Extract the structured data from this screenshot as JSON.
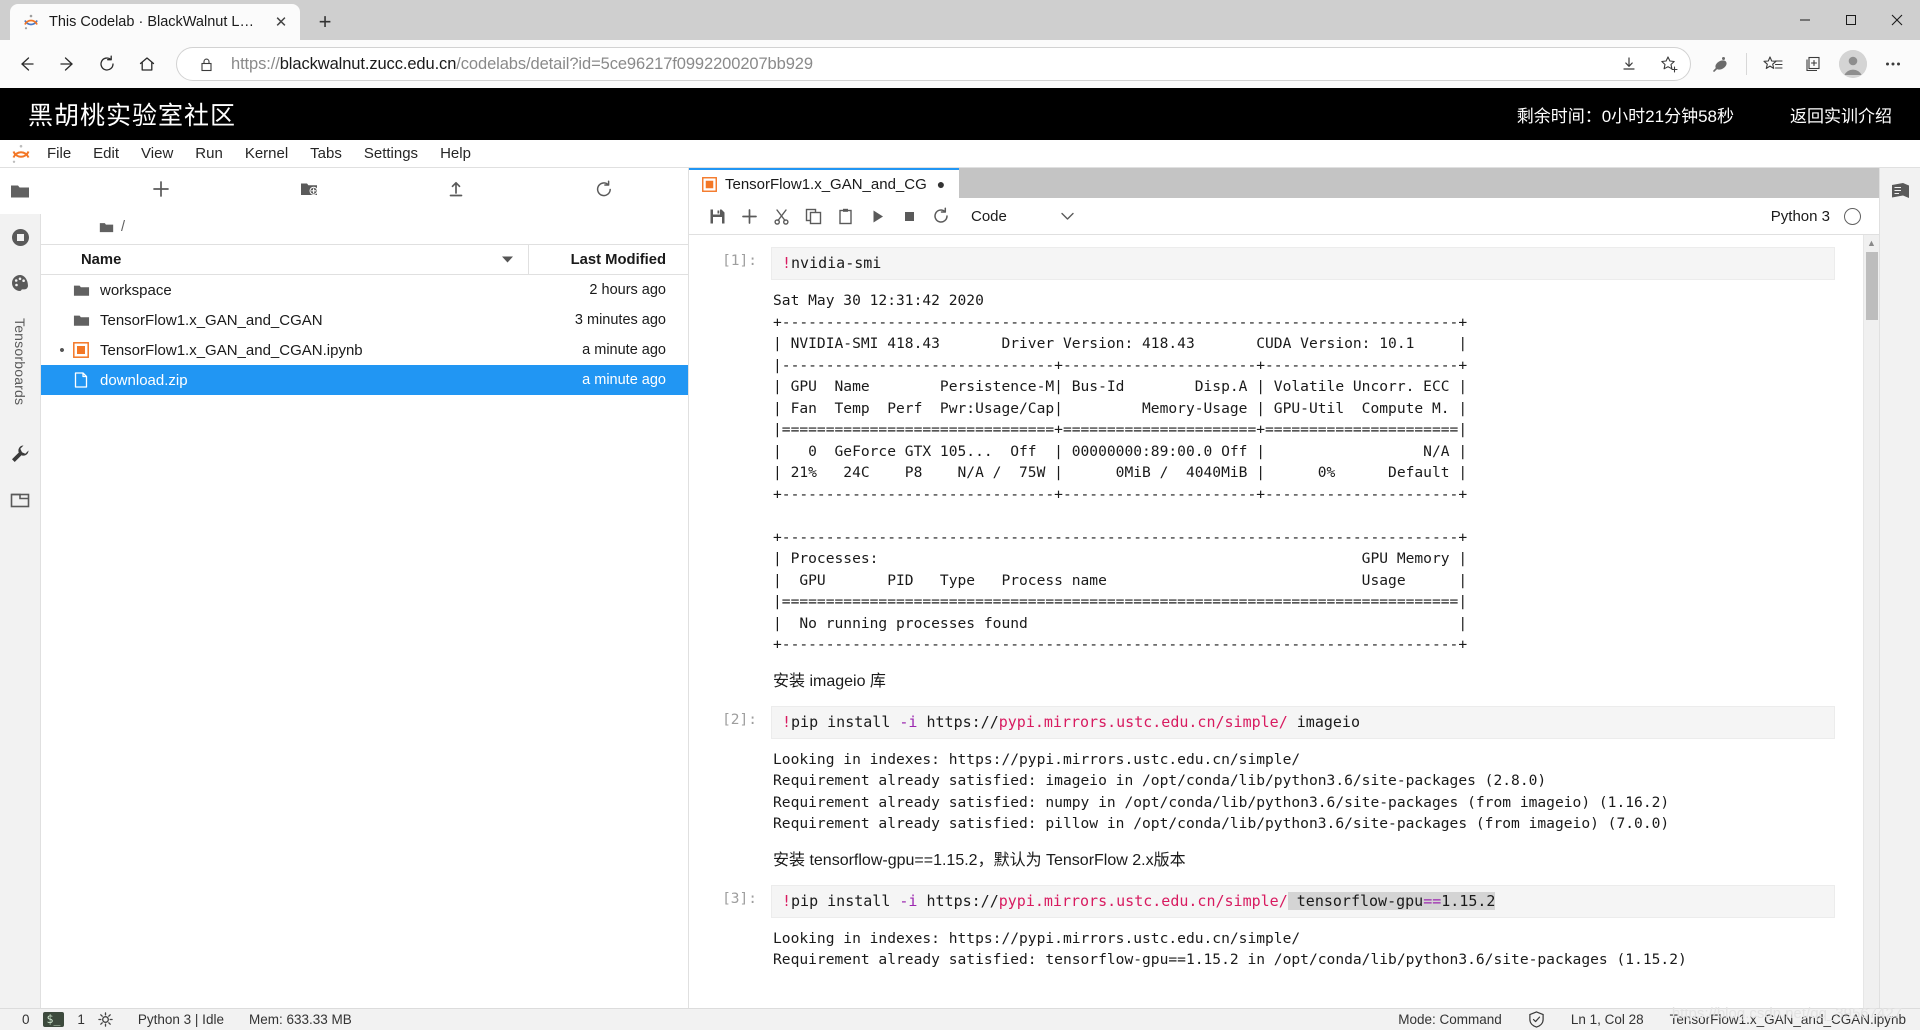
{
  "browser": {
    "tab": {
      "title": "This Codelab · BlackWalnut Labs.",
      "favicon": "jupyter-favicon",
      "close_label": "✕"
    },
    "new_tab_label": "+",
    "window_controls": {
      "minimize": "minimize-icon",
      "maximize": "maximize-icon",
      "close": "close-icon"
    },
    "nav": {
      "back": "back-arrow-icon",
      "forward": "forward-arrow-icon",
      "reload": "reload-icon",
      "home": "home-icon"
    },
    "omnibox": {
      "lock": "lock-icon",
      "url_scheme": "https://",
      "url_host": "blackwalnut.zucc.edu.cn",
      "url_path": "/codelabs/detail?id=5ce96217f0992200207bb929",
      "full_url": "https://blackwalnut.zucc.edu.cn/codelabs/detail?id=5ce96217f0992200207bb929",
      "download_icon": "download-icon",
      "favorite_icon": "add-favorite-icon"
    },
    "toolbar_icons": [
      "collections-radar-icon",
      "favorites-list-icon",
      "collections-icon",
      "profile-avatar-icon",
      "more-options-icon"
    ]
  },
  "site_header": {
    "logo": "黑胡桃实验室社区",
    "remaining_time": "剩余时间：0小时21分钟58秒",
    "back_link": "返回实训介绍"
  },
  "jupyter": {
    "menu": [
      "File",
      "Edit",
      "View",
      "Run",
      "Kernel",
      "Tabs",
      "Settings",
      "Help"
    ],
    "left_rail": [
      {
        "name": "file-browser-icon",
        "label": "",
        "active": true
      },
      {
        "name": "running-terminals-icon",
        "label": "",
        "active": false
      },
      {
        "name": "extension-manager-icon",
        "label": "",
        "active": false
      },
      {
        "name": "tensorboards-icon",
        "label": "Tensorboards",
        "active": false
      },
      {
        "name": "wrench-icon",
        "label": "",
        "active": false
      },
      {
        "name": "open-tabs-icon",
        "label": "",
        "active": false
      }
    ],
    "right_rail": [
      {
        "name": "table-of-contents-icon",
        "label": ""
      }
    ],
    "filebrowser": {
      "toolbar": [
        "new-launcher-icon",
        "new-folder-icon",
        "upload-icon",
        "refresh-icon"
      ],
      "breadcrumb": "/",
      "columns": {
        "name": "Name",
        "last_modified": "Last Modified"
      },
      "items": [
        {
          "name": "workspace",
          "modified": "2 hours ago",
          "type": "folder",
          "selected": false,
          "dirty": false
        },
        {
          "name": "TensorFlow1.x_GAN_and_CGAN",
          "modified": "3 minutes ago",
          "type": "folder",
          "selected": false,
          "dirty": false
        },
        {
          "name": "TensorFlow1.x_GAN_and_CGAN.ipynb",
          "modified": "a minute ago",
          "type": "notebook",
          "selected": false,
          "dirty": true
        },
        {
          "name": "download.zip",
          "modified": "a minute ago",
          "type": "file",
          "selected": true,
          "dirty": false
        }
      ]
    },
    "notebook": {
      "tab_title": "TensorFlow1.x_GAN_and_CG",
      "tab_dirty_marker": "●",
      "toolbar_icons": [
        "save-icon",
        "insert-cell-icon",
        "cut-icon",
        "copy-icon",
        "paste-icon",
        "run-icon",
        "stop-icon",
        "restart-icon"
      ],
      "cell_type": "Code",
      "cell_type_caret": "chevron-down-icon",
      "kernel_name": "Python 3",
      "kernel_status": "kernel-idle-icon",
      "cells": [
        {
          "prompt": "[1]:",
          "source_bang": "!",
          "source_rest": "nvidia-smi",
          "output": "Sat May 30 12:31:42 2020       \n+-----------------------------------------------------------------------------+\n| NVIDIA-SMI 418.43       Driver Version: 418.43       CUDA Version: 10.1     |\n|-------------------------------+----------------------+----------------------+\n| GPU  Name        Persistence-M| Bus-Id        Disp.A | Volatile Uncorr. ECC |\n| Fan  Temp  Perf  Pwr:Usage/Cap|         Memory-Usage | GPU-Util  Compute M. |\n|===============================+======================+======================|\n|   0  GeForce GTX 105...  Off  | 00000000:89:00.0 Off |                  N/A |\n| 21%   24C    P8    N/A /  75W |      0MiB /  4040MiB |      0%      Default |\n+-------------------------------+----------------------+----------------------+\n                                                                               \n+-----------------------------------------------------------------------------+\n| Processes:                                                       GPU Memory |\n|  GPU       PID   Type   Process name                             Usage      |\n|=============================================================================|\n|  No running processes found                                                 |\n+-----------------------------------------------------------------------------+"
        },
        {
          "markdown": "安装 imageio 库"
        },
        {
          "prompt": "[2]:",
          "source_bang": "!",
          "source_pre": "pip install ",
          "source_flag": "-i",
          "source_url_a": " https://",
          "source_url_host": "pypi.mirrors.ustc.edu.cn",
          "source_url_b": "/simple/",
          "source_pkg": " imageio",
          "output": "Looking in indexes: https://pypi.mirrors.ustc.edu.cn/simple/\nRequirement already satisfied: imageio in /opt/conda/lib/python3.6/site-packages (2.8.0)\nRequirement already satisfied: numpy in /opt/conda/lib/python3.6/site-packages (from imageio) (1.16.2)\nRequirement already satisfied: pillow in /opt/conda/lib/python3.6/site-packages (from imageio) (7.0.0)"
        },
        {
          "markdown": "安装 tensorflow-gpu==1.15.2，默认为 TensorFlow 2.x版本"
        },
        {
          "prompt": "[3]:",
          "source_bang": "!",
          "source_pre": "pip install ",
          "source_flag": "-i",
          "source_url_a": " https://",
          "source_url_host": "pypi.mirrors.ustc.edu.cn",
          "source_url_b": "/simple/",
          "source_pkg_sel_name": "tensorflow-gpu",
          "source_pkg_sel_op": "==",
          "source_pkg_sel_ver": "1.15.2",
          "output": "Looking in indexes: https://pypi.mirrors.ustc.edu.cn/simple/\nRequirement already satisfied: tensorflow-gpu==1.15.2 in /opt/conda/lib/python3.6/site-packages (1.15.2)"
        }
      ]
    }
  },
  "statusbar": {
    "kernels_count": "0",
    "terminal_badge": "$_",
    "terminals_count": "1",
    "gear_icon": "gear-icon",
    "kernel_state": "Python 3 | Idle",
    "memory": "Mem: 633.33 MB",
    "mode": "Mode: Command",
    "shield_icon": "shield-check-icon",
    "cursor_position": "Ln 1, Col 28",
    "filename": "TensorFlow1.x_GAN_and_CGAN.ipynb",
    "watermark": "https://blog.csdn.net/qq_39567427"
  }
}
